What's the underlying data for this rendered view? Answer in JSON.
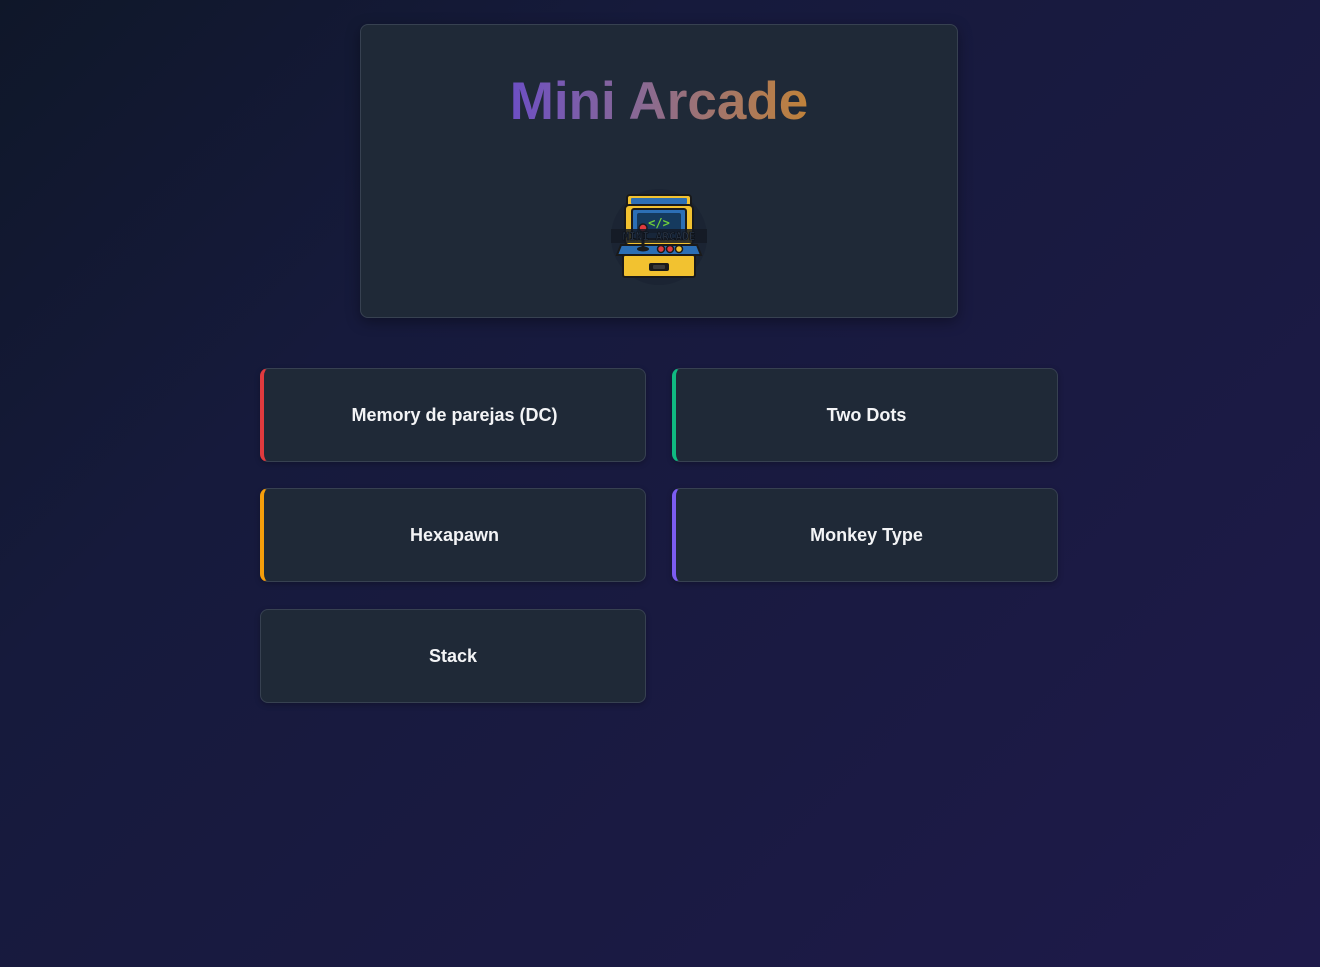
{
  "header": {
    "title": "Mini Arcade",
    "logo_icon": "arcade-cabinet-icon",
    "logo_text": "MINI ARCADE"
  },
  "colors": {
    "title_gradient_start": "#6d4fc4",
    "title_gradient_end": "#c0823a",
    "card_background": "#1f2937"
  },
  "games": [
    {
      "label": "Memory de parejas (DC)",
      "accent": "#e03a3e"
    },
    {
      "label": "Two Dots",
      "accent": "#10b981"
    },
    {
      "label": "Hexapawn",
      "accent": "#f59e0b"
    },
    {
      "label": "Monkey Type",
      "accent": "#7c5cf0"
    },
    {
      "label": "Stack",
      "accent": null
    }
  ]
}
